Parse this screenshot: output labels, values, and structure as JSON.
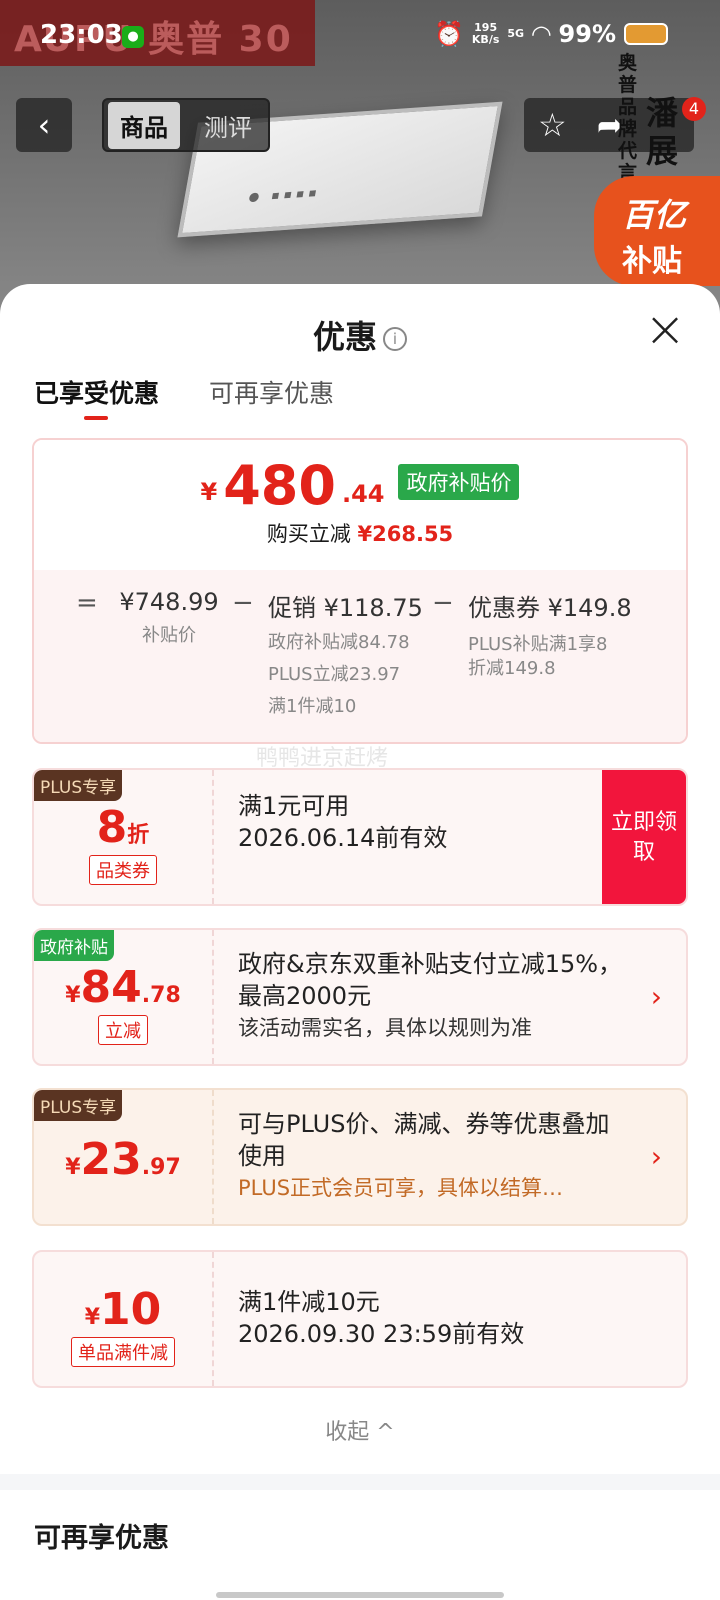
{
  "status_bar": {
    "time": "23:03",
    "network_speed": "195",
    "network_unit": "KB/s",
    "network_type": "5G",
    "battery": "99%"
  },
  "background": {
    "brand": "AUPU 奥普 30",
    "nav_back": "‹",
    "tab_product": "商品",
    "tab_review": "测评",
    "cart_badge": "4",
    "spokesperson_vertical": "奥普品牌代言",
    "spokesperson_name": "潘展",
    "subsidy_badge_line1": "百亿",
    "subsidy_badge_line2": "补贴"
  },
  "sheet": {
    "title": "优惠",
    "close": "×",
    "tabs": [
      {
        "label": "已享受优惠"
      },
      {
        "label": "可再享优惠"
      }
    ]
  },
  "summary": {
    "currency": "¥",
    "price_int": "480",
    "price_dec": ".44",
    "price_tag": "政府补贴价",
    "save_prefix": "购买立减",
    "save_amount": "¥268.55",
    "eq_op": "=",
    "minus_op": "−",
    "base_price": "¥748.99",
    "base_label": "补贴价",
    "promo_main": "促销 ¥118.75",
    "promo_details": [
      "政府补贴减84.78",
      "PLUS立减23.97",
      "满1件减10"
    ],
    "coupon_main": "优惠券 ¥149.8",
    "coupon_details": [
      "PLUS补贴满1享8",
      "折减149.8"
    ]
  },
  "watermark": "鸭鸭进京赶烤",
  "coupons": [
    {
      "tag": "PLUS专享",
      "amount_big": "8",
      "amount_sm": "折",
      "type": "品类券",
      "line1": "满1元可用",
      "line2": "2026.06.14前有效",
      "action": "立即领取"
    },
    {
      "tag": "政府补贴",
      "currency": "¥",
      "amount_big": "84",
      "amount_sm": ".78",
      "type": "立减",
      "line1": "政府&京东双重补贴支付立减15%，最高2000元",
      "line2": "该活动需实名，具体以规则为准"
    },
    {
      "tag": "PLUS专享",
      "currency": "¥",
      "amount_big": "23",
      "amount_sm": ".97",
      "line1": "可与PLUS价、满减、券等优惠叠加使用",
      "line2": "PLUS正式会员可享，具体以结算…"
    },
    {
      "currency": "¥",
      "amount_big": "10",
      "type": "单品满件减",
      "line1": "满1件减10元",
      "line2": "2026.09.30 23:59前有效"
    }
  ],
  "collapse_label": "收起 ^",
  "more_section_title": "可再享优惠"
}
